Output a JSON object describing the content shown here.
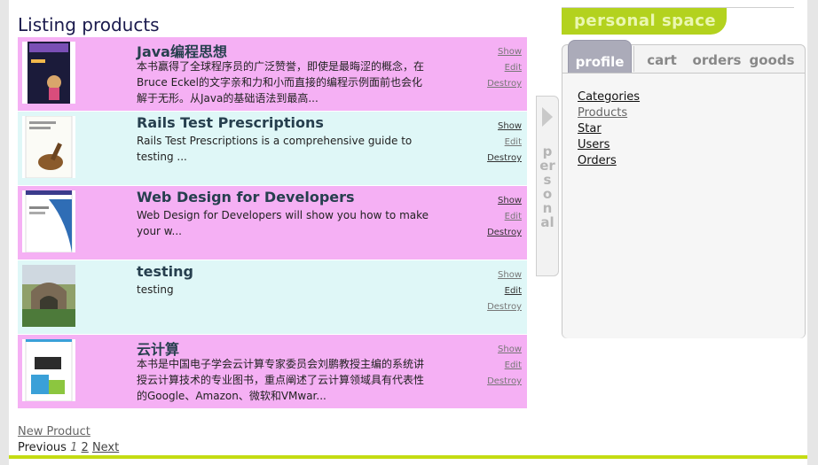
{
  "page_title": "Listing products",
  "products": [
    {
      "title": "Java编程思想",
      "description": "本书赢得了全球程序员的广泛赞誉，即使是最晦涩的概念，在Bruce Eckel的文字亲和力和小而直接的编程示例面前也会化解于无形。从Java的基础语法到最高...",
      "show": "Show",
      "edit": "Edit",
      "destroy": "Destroy"
    },
    {
      "title": "Rails Test Prescriptions",
      "description": "Rails Test Prescriptions is a comprehensive guide to testing ...",
      "show": "Show",
      "edit": "Edit",
      "destroy": "Destroy"
    },
    {
      "title": "Web Design for Developers",
      "description": "Web Design for Developers will show you how to make your w...",
      "show": "Show",
      "edit": "Edit",
      "destroy": "Destroy"
    },
    {
      "title": "testing",
      "description": "testing",
      "show": "Show",
      "edit": "Edit",
      "destroy": "Destroy"
    },
    {
      "title": "云计算",
      "description": "本书是中国电子学会云计算专家委员会刘鹏教授主编的系统讲授云计算技术的专业图书，重点阐述了云计算领域具有代表性的Google、Amazon、微软和VMwar...",
      "show": "Show",
      "edit": "Edit",
      "destroy": "Destroy"
    }
  ],
  "new_product_link": "New Product",
  "pagination": {
    "previous": "Previous",
    "current": "1",
    "page2": "2",
    "next": "Next"
  },
  "personal_handle": "personal",
  "personal_space": {
    "banner": "personal space",
    "tabs": [
      "profile",
      "cart",
      "orders",
      "goods"
    ],
    "active_tab": "profile",
    "links": [
      "Categories",
      "Products",
      "Star",
      "Users",
      "Orders"
    ],
    "selected_link": "Products"
  },
  "colors": {
    "row_pink": "#f5b0f4",
    "row_cyan": "#dff7f7",
    "accent_green": "#b3d21e"
  }
}
